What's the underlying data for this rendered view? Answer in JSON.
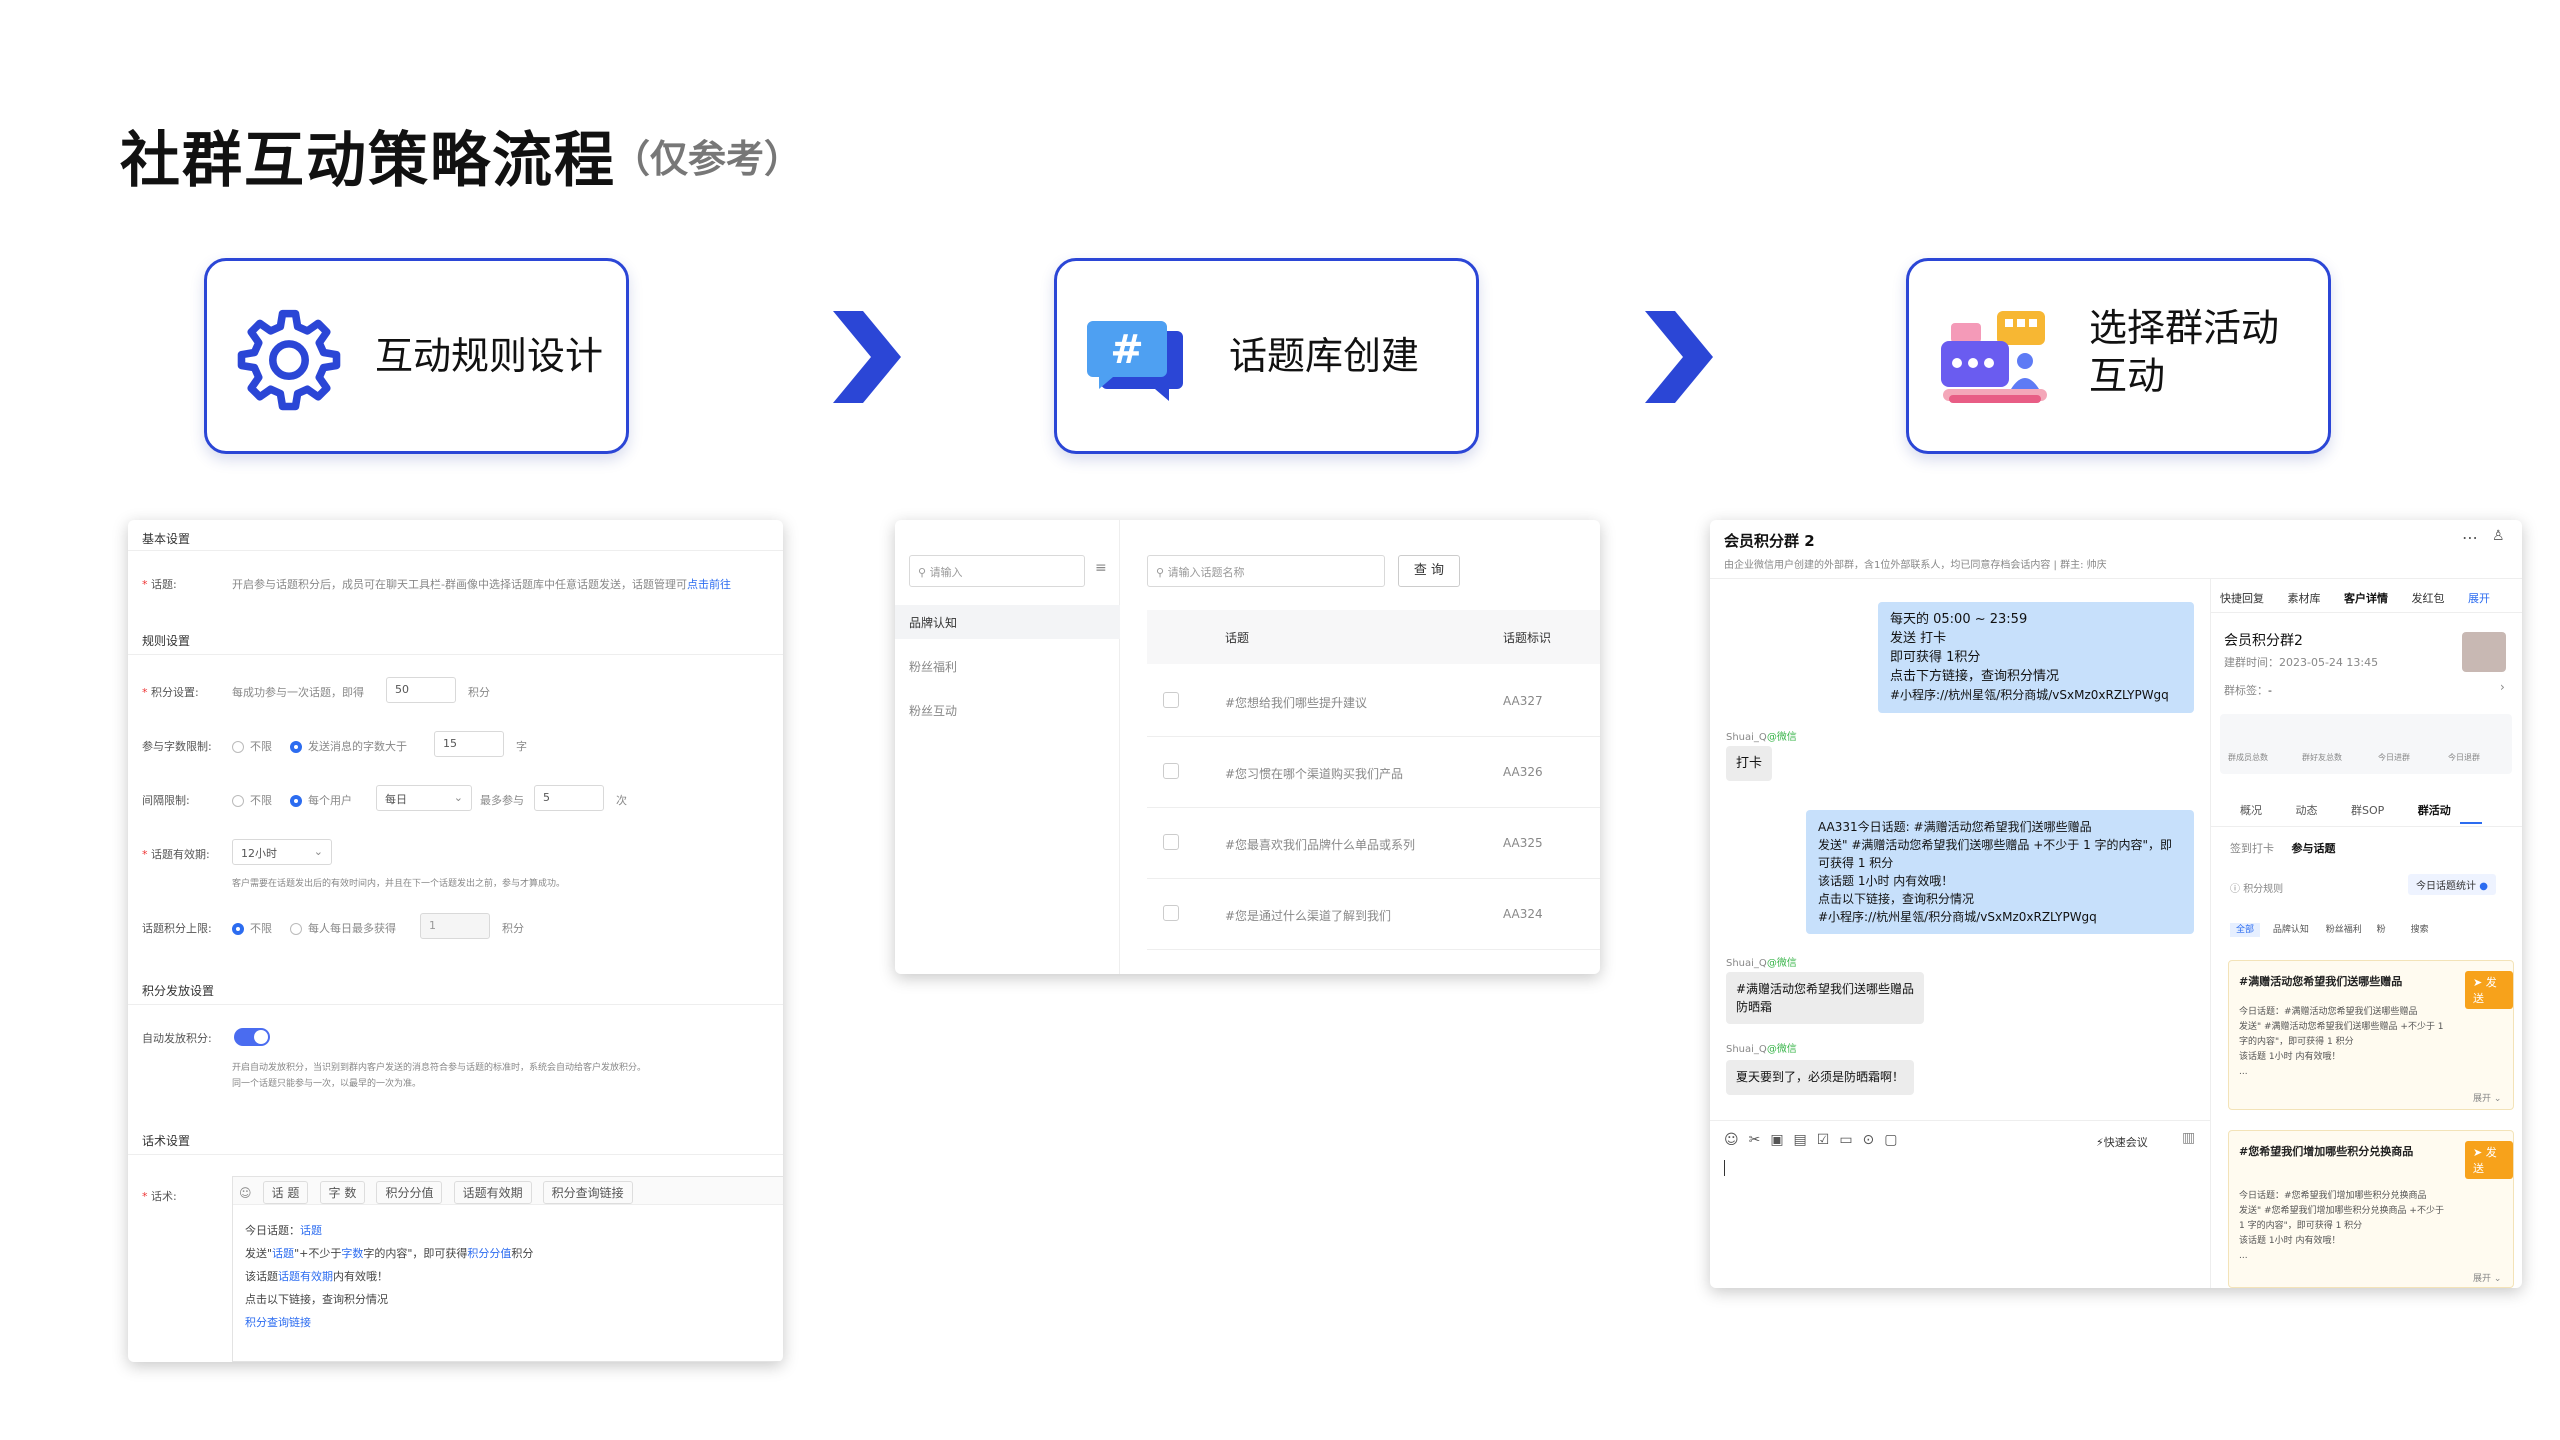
{
  "page": {
    "title": "社群互动策略流程",
    "subtitle": "（仅参考）"
  },
  "steps": [
    {
      "label": "互动规则设计",
      "icon": "gear-icon"
    },
    {
      "label": "话题库创建",
      "icon": "hashtag-chat-icon"
    },
    {
      "label_line1": "选择群活动",
      "label_line2": "互动",
      "icon": "group-chat-icon"
    }
  ],
  "colors": {
    "accent": "#2b46d6",
    "link": "#2c6cf0",
    "bubble": "#c7e0fb",
    "orange": "#f7a21b"
  },
  "settings": {
    "basic_title": "基本设置",
    "topic_label": "话题:",
    "topic_desc": "开启参与话题积分后，成员可在聊天工具栏-群画像中选择话题库中任意话题发送，话题管理可",
    "topic_link": "点击前往",
    "rule_title": "规则设置",
    "points_label": "积分设置:",
    "points_prefix": "每成功参与一次话题，即得",
    "points_value": "50",
    "points_unit": "积分",
    "wordlimit_label": "参与字数限制:",
    "opt_unlimited": "不限",
    "wordlimit_opt2": "发送消息的字数大于",
    "wordlimit_value": "15",
    "wordlimit_unit": "字",
    "interval_label": "间隔限制:",
    "interval_opt2": "每个用户",
    "interval_select": "每日",
    "interval_mid": "最多参与",
    "interval_value": "5",
    "interval_unit": "次",
    "valid_label": "话题有效期:",
    "valid_select": "12小时",
    "valid_hint": "客户需要在话题发出后的有效时间内，并且在下一个话题发出之前，参与才算成功。",
    "cap_label": "话题积分上限:",
    "cap_opt2": "每人每日最多获得",
    "cap_value": "1",
    "cap_unit": "积分",
    "issue_title": "积分发放设置",
    "auto_label": "自动发放积分:",
    "auto_hint1": "开启自动发放积分，当识别到群内客户发送的消息符合参与话题的标准时，系统会自动给客户发放积分。",
    "auto_hint2": "同一个话题只能参与一次，以最早的一次为准。",
    "script_title": "话术设置",
    "script_label": "话术:",
    "tags": [
      "话 题",
      "字 数",
      "积分分值",
      "话题有效期",
      "积分查询链接"
    ],
    "script_l1a": "今日话题：",
    "script_l1b": "话题",
    "script_l2a": "发送\"",
    "script_l2b": "话题",
    "script_l2c": "\"+不少于",
    "script_l2d": "字数",
    "script_l2e": "字的内容\"，即可获得",
    "script_l2f": "积分分值",
    "script_l2g": "积分",
    "script_l3a": "该话题",
    "script_l3b": "话题有效期",
    "script_l3c": "内有效哦！",
    "script_l4": "点击以下链接，查询积分情况",
    "script_l5": "积分查询链接"
  },
  "topics": {
    "search_placeholder": "请输入",
    "categories": [
      "品牌认知",
      "粉丝福利",
      "粉丝互动"
    ],
    "name_placeholder": "请输入话题名称",
    "query_button": "查 询",
    "col_topic": "话题",
    "col_id": "话题标识",
    "rows": [
      {
        "topic": "#您想给我们哪些提升建议",
        "id": "AA327"
      },
      {
        "topic": "#您习惯在哪个渠道购买我们产品",
        "id": "AA326"
      },
      {
        "topic": "#您最喜欢我们品牌什么单品或系列",
        "id": "AA325"
      },
      {
        "topic": "#您是通过什么渠道了解到我们",
        "id": "AA324"
      }
    ]
  },
  "chat": {
    "group_name": "会员积分群 2",
    "group_desc": "由企业微信用户创建的外部群，含1位外部联系人，均已同意存档会话内容 | 群主: 帅庆",
    "msg1": [
      "每天的 05:00 ~ 23:59",
      "发送 打卡",
      "即可获得 1积分",
      "点击下方链接，查询积分情况",
      "#小程序://杭州星瓴/积分商城/vSxMz0xRZLYPWgq"
    ],
    "sender": "Shuai_Q",
    "sender_tag": "@微信",
    "msg2": "打卡",
    "msg3": [
      "AA331今日话题: #满赠活动您希望我们送哪些赠品",
      "发送\" #满赠活动您希望我们送哪些赠品 +不少于 1 字的内容\"，即",
      "可获得 1 积分",
      "该话题 1小时 内有效哦！",
      "点击以下链接，查询积分情况",
      "#小程序://杭州星瓴/积分商城/vSxMz0xRZLYPWgq"
    ],
    "msg4": [
      "#满赠活动您希望我们送哪些赠品",
      "防晒霜"
    ],
    "msg5": "夏天要到了，必须是防晒霜啊！",
    "quick_meeting": "快速会议",
    "side_tabs": [
      "快捷回复",
      "素材库",
      "客户详情",
      "发红包",
      "展开"
    ],
    "side_group": "会员积分群2",
    "side_created": "建群时间：2023-05-24 13:45",
    "side_tag_label": "群标签：",
    "side_tag_value": "-",
    "stats": [
      "群成员总数",
      "群好友总数",
      "今日进群",
      "今日退群"
    ],
    "func_tabs": [
      "概况",
      "动态",
      "群SOP",
      "群活动"
    ],
    "sub_tabs": [
      "签到打卡",
      "参与话题"
    ],
    "rule_link": "积分规则",
    "today_stats": "今日话题统计",
    "filters": [
      "全部",
      "品牌认知",
      "粉丝福利",
      "粉",
      "搜索"
    ],
    "card1_title": "#满赠活动您希望我们送哪些赠品",
    "card1_lines": [
      "今日话题：#满赠活动您希望我们送哪些赠品",
      "发送\" #满赠活动您希望我们送哪些赠品 +不少于 1",
      "字的内容\"，即可获得 1 积分",
      "该话题 1小时 内有效哦！",
      "..."
    ],
    "send_label": "发送",
    "expand_label": "展开",
    "card2_title": "#您希望我们增加哪些积分兑换商品",
    "card2_lines": [
      "今日话题：#您希望我们增加哪些积分兑换商品",
      "发送\" #您希望我们增加哪些积分兑换商品 +不少于",
      "1 字的内容\"，即可获得 1 积分",
      "该话题 1小时 内有效哦！",
      "..."
    ]
  }
}
